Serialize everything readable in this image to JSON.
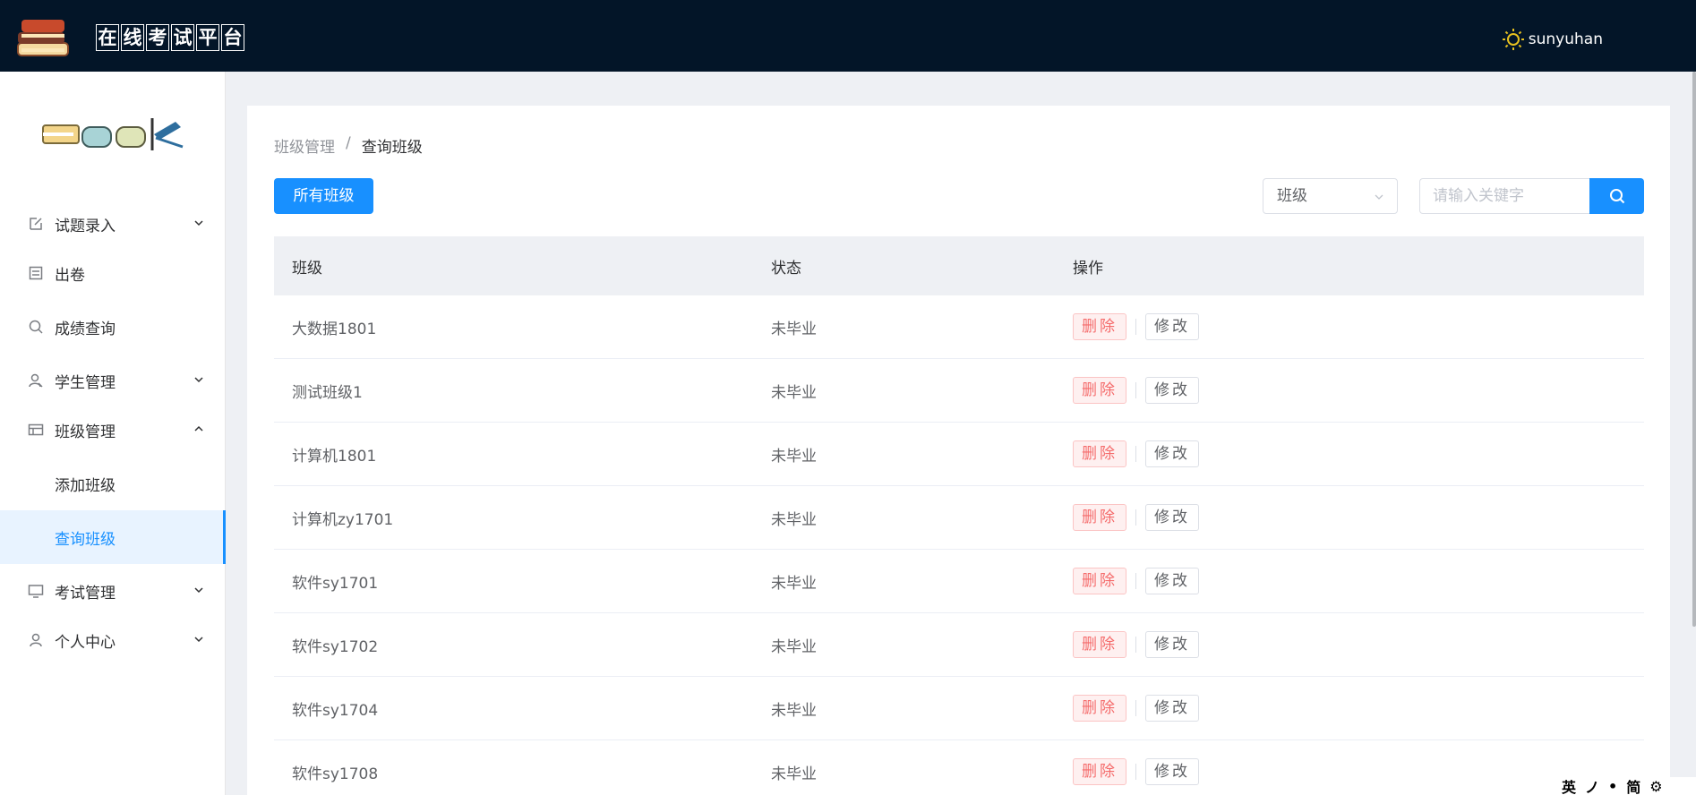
{
  "header": {
    "title_chars": [
      "在",
      "线",
      "考",
      "试",
      "平",
      "台"
    ],
    "username": "sunyuhan",
    "user_icon": "sun-icon"
  },
  "sidebar": {
    "items": [
      {
        "label": "试题录入",
        "icon": "edit-icon",
        "arrow": "down"
      },
      {
        "label": "出卷",
        "icon": "document-icon",
        "arrow": ""
      },
      {
        "label": "成绩查询",
        "icon": "search-icon",
        "arrow": ""
      },
      {
        "label": "学生管理",
        "icon": "user-manage-icon",
        "arrow": "down"
      },
      {
        "label": "班级管理",
        "icon": "list-icon",
        "arrow": "up",
        "children": [
          {
            "label": "添加班级",
            "active": false
          },
          {
            "label": "查询班级",
            "active": true
          }
        ]
      },
      {
        "label": "考试管理",
        "icon": "monitor-icon",
        "arrow": "down"
      },
      {
        "label": "个人中心",
        "icon": "person-icon",
        "arrow": "down"
      }
    ]
  },
  "breadcrumb": {
    "parent": "班级管理",
    "separator": "/",
    "current": "查询班级"
  },
  "toolbar": {
    "all_button": "所有班级",
    "select_value": "班级",
    "search_placeholder": "请输入关键字"
  },
  "table": {
    "headers": [
      "班级",
      "状态",
      "操作"
    ],
    "delete_label": "删除",
    "edit_label": "修改",
    "rows": [
      {
        "name": "大数据1801",
        "status": "未毕业"
      },
      {
        "name": "测试班级1",
        "status": "未毕业"
      },
      {
        "name": "计算机1801",
        "status": "未毕业"
      },
      {
        "name": "计算机zy1701",
        "status": "未毕业"
      },
      {
        "name": "软件sy1701",
        "status": "未毕业"
      },
      {
        "name": "软件sy1702",
        "status": "未毕业"
      },
      {
        "name": "软件sy1704",
        "status": "未毕业"
      },
      {
        "name": "软件sy1708",
        "status": "未毕业"
      }
    ]
  },
  "ime_toolbar": [
    "英",
    "ノ",
    "•",
    "简",
    "⚙"
  ],
  "colors": {
    "header_bg": "#031528",
    "accent": "#1890ff",
    "danger": "#f56c6c",
    "page_bg": "#eef0f4"
  }
}
